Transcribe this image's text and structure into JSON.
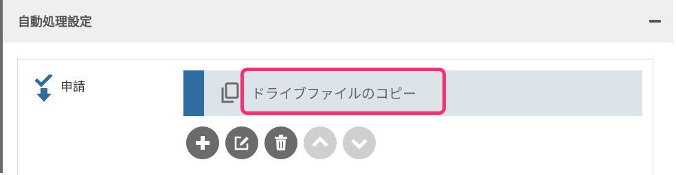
{
  "panel": {
    "title": "自動処理設定",
    "collapse_icon": "minus-icon"
  },
  "step": {
    "icon": "double-arrow-down-check-icon",
    "label": "申請"
  },
  "process_card": {
    "icon": "copy-icon",
    "label": "ドライブファイルのコピー",
    "accent_color": "#2f6ca4",
    "background_color": "#dce4ea",
    "highlight_color": "#ff2e6c"
  },
  "actions": [
    {
      "name": "add",
      "icon": "plus-icon",
      "enabled": true
    },
    {
      "name": "edit",
      "icon": "edit-icon",
      "enabled": true
    },
    {
      "name": "delete",
      "icon": "trash-icon",
      "enabled": true
    },
    {
      "name": "move-up",
      "icon": "chevron-up-icon",
      "enabled": false
    },
    {
      "name": "move-down",
      "icon": "chevron-down-icon",
      "enabled": false
    }
  ]
}
